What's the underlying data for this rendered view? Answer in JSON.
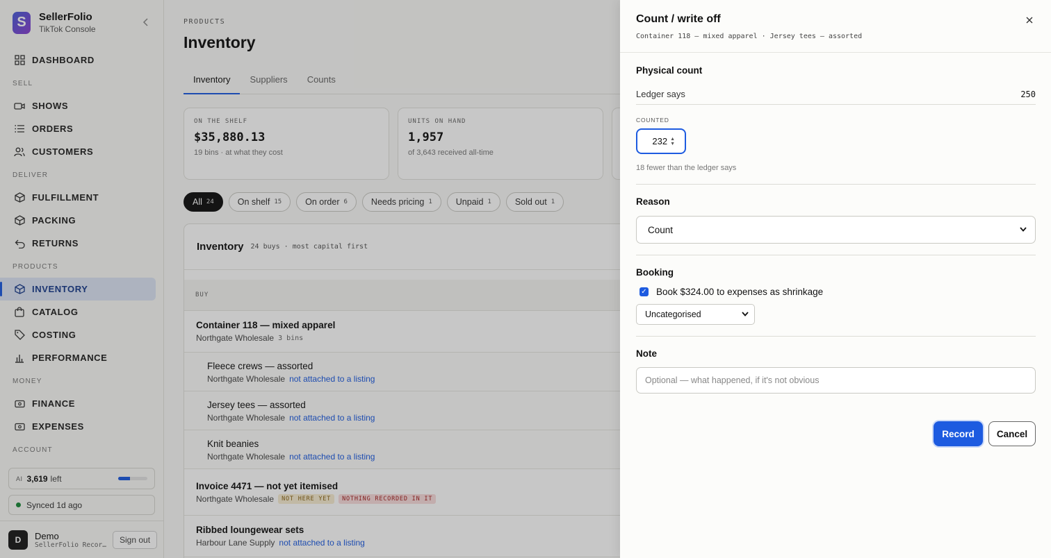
{
  "brand": {
    "name": "SellerFolio",
    "sub": "TikTok Console"
  },
  "nav": {
    "dashboard": "DASHBOARD",
    "sec_sell": "SELL",
    "shows": "SHOWS",
    "orders": "ORDERS",
    "customers": "CUSTOMERS",
    "sec_deliver": "DELIVER",
    "fulfillment": "FULFILLMENT",
    "packing": "PACKING",
    "returns": "RETURNS",
    "sec_products": "PRODUCTS",
    "inventory": "INVENTORY",
    "catalog": "CATALOG",
    "costing": "COSTING",
    "performance": "PERFORMANCE",
    "sec_money": "MONEY",
    "finance": "FINANCE",
    "expenses": "EXPENSES",
    "sec_account": "ACCOUNT"
  },
  "ai": {
    "tag": "AI",
    "value": "3,619",
    "suffix": "left",
    "level": 0.4
  },
  "sync": {
    "label": "Synced 1d ago"
  },
  "user": {
    "initial": "D",
    "name": "Demo",
    "sub": "SellerFolio Recor…",
    "signout": "Sign out"
  },
  "page": {
    "crumb": "PRODUCTS",
    "title": "Inventory"
  },
  "tabs": [
    "Inventory",
    "Suppliers",
    "Counts"
  ],
  "stats": [
    {
      "label": "ON THE SHELF",
      "value": "$35,880.13",
      "sub": "19 bins · at what they cost"
    },
    {
      "label": "UNITS ON HAND",
      "value": "1,957",
      "sub": "of 3,643 received all-time"
    }
  ],
  "chips": [
    {
      "label": "All",
      "count": "24"
    },
    {
      "label": "On shelf",
      "count": "15"
    },
    {
      "label": "On order",
      "count": "6"
    },
    {
      "label": "Needs pricing",
      "count": "1"
    },
    {
      "label": "Unpaid",
      "count": "1"
    },
    {
      "label": "Sold out",
      "count": "1"
    }
  ],
  "table": {
    "title": "Inventory",
    "meta": "24 buys · most capital first",
    "col_buy": "BUY",
    "rows": [
      {
        "title": "Container 118 — mixed apparel",
        "supplier": "Northgate Wholesale",
        "bins": "3 bins"
      },
      {
        "title": "Fleece crews — assorted",
        "supplier": "Northgate Wholesale",
        "link": "not attached to a listing"
      },
      {
        "title": "Jersey tees — assorted",
        "supplier": "Northgate Wholesale",
        "link": "not attached to a listing"
      },
      {
        "title": "Knit beanies",
        "supplier": "Northgate Wholesale",
        "link": "not attached to a listing"
      },
      {
        "title": "Invoice 4471 — not yet itemised",
        "supplier": "Northgate Wholesale",
        "tag1": "NOT HERE YET",
        "tag2": "NOTHING RECORDED IN IT"
      },
      {
        "title": "Ribbed loungewear sets",
        "supplier": "Harbour Lane Supply",
        "link": "not attached to a listing"
      }
    ]
  },
  "drawer": {
    "title": "Count / write off",
    "subtitle": "Container 118 — mixed apparel · Jersey tees — assorted",
    "physical_title": "Physical count",
    "ledger_label": "Ledger says",
    "ledger_value": "250",
    "counted_label": "COUNTED",
    "counted_value": "232",
    "hint": "18 fewer than the ledger says",
    "reason_title": "Reason",
    "reason_value": "Count",
    "booking_title": "Booking",
    "booking_check": "Book $324.00 to expenses as shrinkage",
    "category_value": "Uncategorised",
    "note_title": "Note",
    "note_placeholder": "Optional — what happened, if it's not obvious",
    "record": "Record",
    "cancel": "Cancel"
  },
  "colors": {
    "accent": "#1d5be0",
    "active_nav_bg": "#dde5f5"
  }
}
